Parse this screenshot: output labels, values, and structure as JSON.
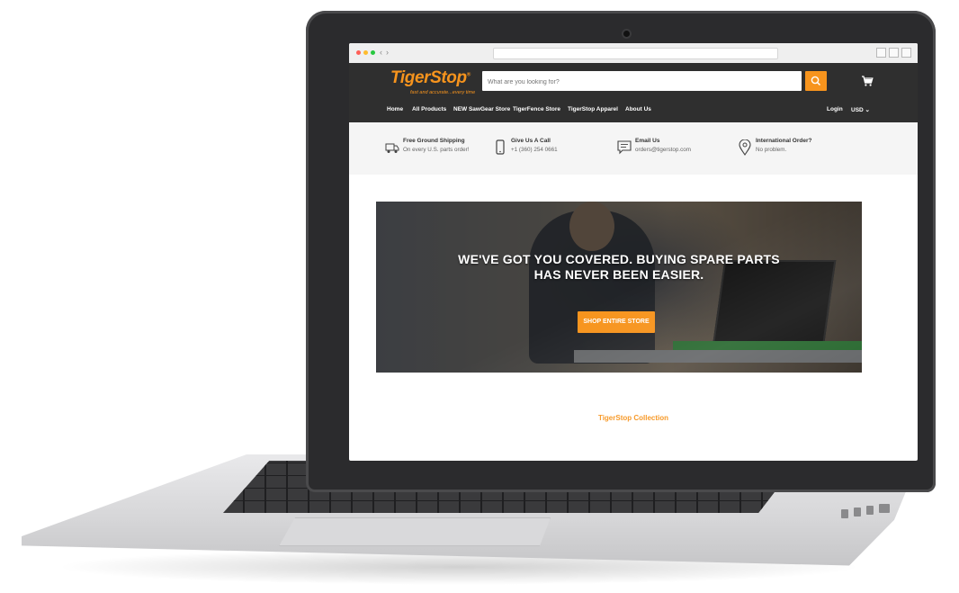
{
  "browser": {
    "traffic_lights": [
      "#ff5f57",
      "#febc2e",
      "#28c840"
    ],
    "back_icon": "‹",
    "forward_icon": "›"
  },
  "site": {
    "logo": "TigerStop",
    "logo_mark": "®",
    "tagline": "fast and accurate...every time",
    "search_placeholder": "What are you looking for?",
    "accent_color": "#f7941d",
    "header_bg": "#2f2f2f"
  },
  "menu": {
    "items": [
      "Home",
      "All Products",
      "NEW SawGear Store",
      "TigerFence Store",
      "TigerStop Apparel",
      "About Us"
    ],
    "login": "Login",
    "currency": "USD ⌄"
  },
  "info": [
    {
      "icon": "truck-icon",
      "title": "Free Ground Shipping",
      "sub": "On every U.S. parts order!"
    },
    {
      "icon": "phone-icon",
      "title": "Give Us A Call",
      "sub": "+1 (360) 254 0661"
    },
    {
      "icon": "chat-icon",
      "title": "Email Us",
      "sub": "orders@tigerstop.com"
    },
    {
      "icon": "map-pin-icon",
      "title": "International Order?",
      "sub": "No problem."
    }
  ],
  "hero": {
    "line1": "WE'VE GOT YOU COVERED. BUYING SPARE PARTS",
    "line2": "HAS NEVER BEEN EASIER.",
    "button": "SHOP ENTIRE STORE"
  },
  "collection_title": "TigerStop Collection"
}
